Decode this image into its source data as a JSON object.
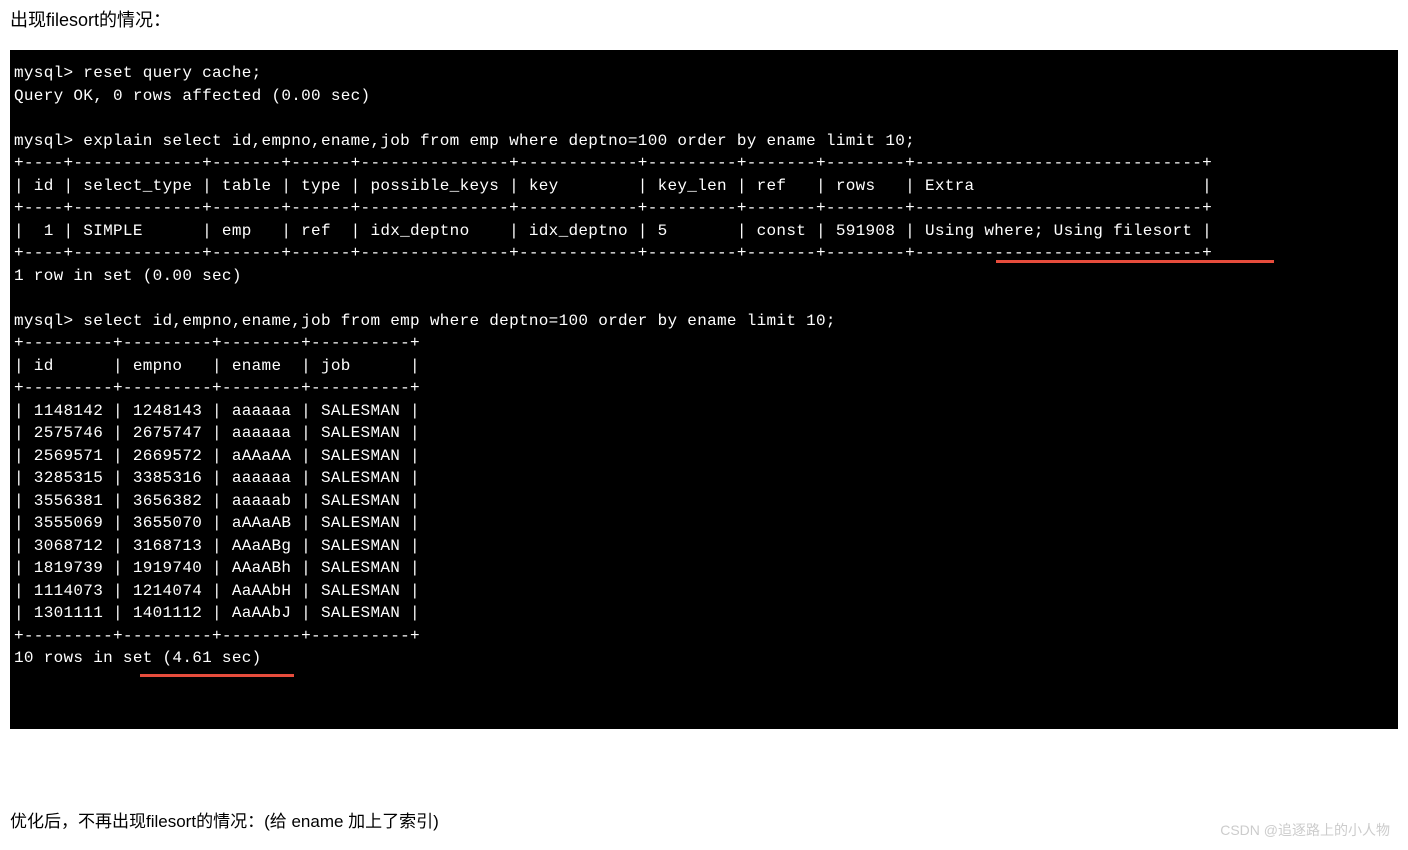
{
  "heading1": "出现filesort的情况：",
  "terminal": {
    "line1": "mysql> reset query cache;",
    "line2": "Query OK, 0 rows affected (0.00 sec)",
    "blank1": "",
    "line3": "mysql> explain select id,empno,ename,job from emp where deptno=100 order by ename limit 10;",
    "sep1": "+----+-------------+-------+------+---------------+------------+---------+-------+--------+-----------------------------+",
    "hdr1": "| id | select_type | table | type | possible_keys | key        | key_len | ref   | rows   | Extra                       |",
    "sep2": "+----+-------------+-------+------+---------------+------------+---------+-------+--------+-----------------------------+",
    "row1": "|  1 | SIMPLE      | emp   | ref  | idx_deptno    | idx_deptno | 5       | const | 591908 | Using where; Using filesort |",
    "sep3": "+----+-------------+-------+------+---------------+------------+---------+-------+--------+-----------------------------+",
    "res1": "1 row in set (0.00 sec)",
    "blank2": "",
    "line4": "mysql> select id,empno,ename,job from emp where deptno=100 order by ename limit 10;",
    "sep4": "+---------+---------+--------+----------+",
    "hdr2": "| id      | empno   | ename  | job      |",
    "sep5": "+---------+---------+--------+----------+",
    "d1": "| 1148142 | 1248143 | aaaaaa | SALESMAN |",
    "d2": "| 2575746 | 2675747 | aaaaaa | SALESMAN |",
    "d3": "| 2569571 | 2669572 | aAAaAA | SALESMAN |",
    "d4": "| 3285315 | 3385316 | aaaaaa | SALESMAN |",
    "d5": "| 3556381 | 3656382 | aaaaab | SALESMAN |",
    "d6": "| 3555069 | 3655070 | aAAaAB | SALESMAN |",
    "d7": "| 3068712 | 3168713 | AAaABg | SALESMAN |",
    "d8": "| 1819739 | 1919740 | AAaABh | SALESMAN |",
    "d9": "| 1114073 | 1214074 | AaAAbH | SALESMAN |",
    "d10": "| 1301111 | 1401112 | AaAAbJ | SALESMAN |",
    "sep6": "+---------+---------+--------+----------+",
    "res2": "10 rows in set (4.61 sec)"
  },
  "heading2": "优化后，不再出现filesort的情况：(给 ename 加上了索引)",
  "watermark": "CSDN @追逐路上的小人物"
}
